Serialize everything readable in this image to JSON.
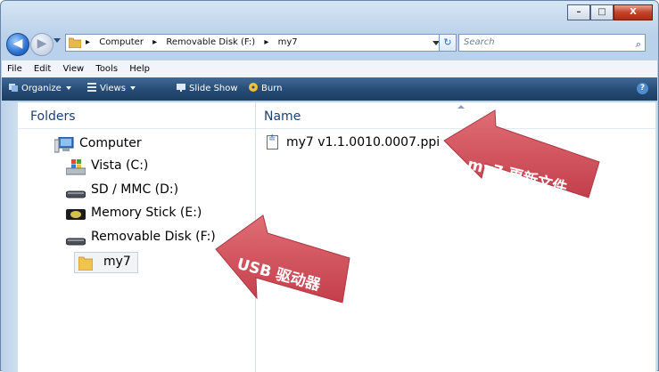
{
  "titlebar": {
    "minimize": "–",
    "maximize": "□",
    "close": "X"
  },
  "address_bar": {
    "back_icon": "back-arrow-icon",
    "forward_icon": "forward-arrow-icon",
    "breadcrumbs": [
      "Computer",
      "Removable Disk (F:)",
      "my7"
    ],
    "separator": "▸",
    "refresh_glyph": "↻",
    "search_placeholder": "Search"
  },
  "menu": [
    "File",
    "Edit",
    "View",
    "Tools",
    "Help"
  ],
  "toolbar": {
    "organize": "Organize",
    "views": "Views",
    "slideshow": "Slide Show",
    "burn": "Burn",
    "help": "?"
  },
  "folders_pane": {
    "heading": "Folders",
    "items": [
      {
        "label": "Computer",
        "icon": "computer-icon"
      },
      {
        "label": "Vista (C:)",
        "icon": "windows-drive-icon"
      },
      {
        "label": "SD / MMC (D:)",
        "icon": "removable-drive-icon"
      },
      {
        "label": "Memory Stick (E:)",
        "icon": "memory-stick-icon"
      },
      {
        "label": "Removable Disk (F:)",
        "icon": "removable-drive-icon"
      },
      {
        "label": "my7",
        "icon": "folder-icon"
      }
    ]
  },
  "file_list": {
    "column_name": "Name",
    "files": [
      {
        "name": "my7 v1.1.0010.0007.ppi",
        "icon": "ppi-file-icon"
      }
    ]
  },
  "callouts": {
    "file_callout": "my7 更新文件",
    "drive_callout": "USB 驱动器",
    "arrow_color": "#cf4a55"
  }
}
